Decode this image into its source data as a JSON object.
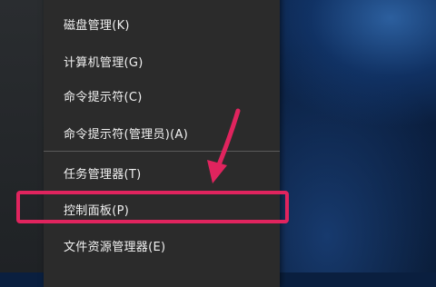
{
  "menu": {
    "items": [
      {
        "label": "磁盘管理(K)"
      },
      {
        "label": "计算机管理(G)"
      },
      {
        "label": "命令提示符(C)"
      },
      {
        "label": "命令提示符(管理员)(A)"
      },
      {
        "label": "任务管理器(T)"
      },
      {
        "label": "控制面板(P)"
      },
      {
        "label": "文件资源管理器(E)"
      }
    ],
    "highlighted_item": "控制面板(P)"
  },
  "annotation": {
    "highlight_color": "#e0245e",
    "arrow_color": "#e0245e"
  }
}
